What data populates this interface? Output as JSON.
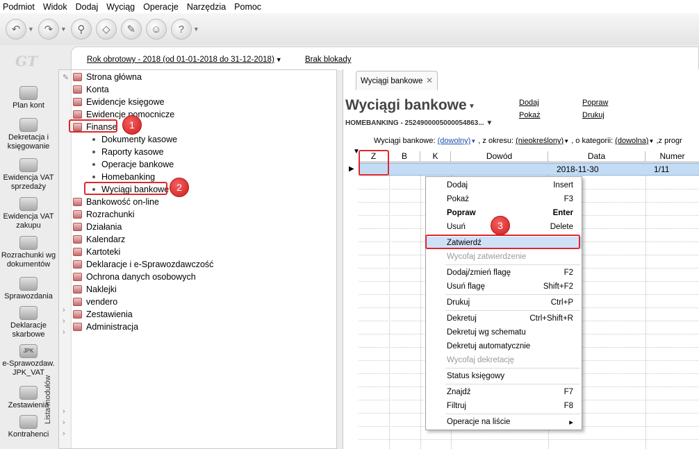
{
  "menubar": {
    "items": [
      "Podmiot",
      "Widok",
      "Dodaj",
      "Wyciąg",
      "Operacje",
      "Narzędzia",
      "Pomoc"
    ]
  },
  "logo": "GT",
  "leftbar": {
    "items": [
      "Plan kont",
      "Dekretacja i księgowanie",
      "Ewidencja VAT sprzedaży",
      "Ewidencja VAT zakupu",
      "Rozrachunki wg dokumentów",
      "Sprawozdania",
      "Deklaracje skarbowe",
      "e-Sprawozdaw. JPK_VAT",
      "Zestawienia",
      "Kontrahenci"
    ],
    "jpk_icon_text": "JPK"
  },
  "header": {
    "year": "Rok obrotowy - 2018  (od 01-01-2018 do 31-12-2018)",
    "year_caret": "▼",
    "lock": "Brak blokady"
  },
  "tree": {
    "strip_label": "Lista modułów",
    "items": [
      "Strona główna",
      "Konta",
      "Ewidencje księgowe",
      "Ewidencje pomocnicze",
      "Finanse",
      "Dokumenty kasowe",
      "Raporty kasowe",
      "Operacje bankowe",
      "Homebanking",
      "Wyciągi bankowe",
      "Bankowość on-line",
      "Rozrachunki",
      "Działania",
      "Kalendarz",
      "Kartoteki",
      "Deklaracje i e-Sprawozdawczość",
      "Ochrona danych osobowych",
      "Naklejki",
      "vendero",
      "Zestawienia",
      "Administracja"
    ]
  },
  "badges": {
    "b1": "1",
    "b2": "2",
    "b3": "3"
  },
  "panel": {
    "tab_label": "Wyciągi bankowe",
    "tab_close": "✕",
    "title": "Wyciągi bankowe",
    "title_caret": "▼",
    "actions": {
      "add": "Dodaj",
      "show": "Pokaż",
      "edit": "Popraw",
      "print": "Drukuj"
    },
    "subtitle": "HOMEBANKING - 2524900005000054863...",
    "subtitle_caret": "▼",
    "filter": {
      "label1": "Wyciągi bankowe:",
      "val1": "(dowolny)",
      "label2": ", z okresu:",
      "val2": "(nieokreślony)",
      "label3": ", o kategorii:",
      "val3": "(dowolna)",
      "label4": ",z progr"
    },
    "columns": [
      "Z",
      "B",
      "K",
      "Dowód",
      "Data",
      "Numer"
    ],
    "row": {
      "date": "2018-11-30",
      "number": "1/11"
    }
  },
  "context_menu": {
    "items": [
      {
        "label": "Dodaj",
        "shortcut": "Insert"
      },
      {
        "label": "Pokaż",
        "shortcut": "F3"
      },
      {
        "label": "Popraw",
        "shortcut": "Enter"
      },
      {
        "label": "Usuń",
        "shortcut": "Delete"
      },
      {
        "label": "Zatwierdź",
        "shortcut": ""
      },
      {
        "label": "Wycofaj zatwierdzenie",
        "shortcut": ""
      },
      {
        "label": "Dodaj/zmień flagę",
        "shortcut": "F2"
      },
      {
        "label": "Usuń flagę",
        "shortcut": "Shift+F2"
      },
      {
        "label": "Drukuj",
        "shortcut": "Ctrl+P"
      },
      {
        "label": "Dekretuj",
        "shortcut": "Ctrl+Shift+R"
      },
      {
        "label": "Dekretuj wg schematu",
        "shortcut": ""
      },
      {
        "label": "Dekretuj automatycznie",
        "shortcut": ""
      },
      {
        "label": "Wycofaj dekretację",
        "shortcut": ""
      },
      {
        "label": "Status księgowy",
        "shortcut": ""
      },
      {
        "label": "Znajdź",
        "shortcut": "F7"
      },
      {
        "label": "Filtruj",
        "shortcut": "F8"
      },
      {
        "label": "Operacje na liście",
        "shortcut": "▸"
      }
    ]
  },
  "colors": {
    "highlight": "#e0262b",
    "selection": "#c2dcf5",
    "link": "#1a4fb0"
  }
}
